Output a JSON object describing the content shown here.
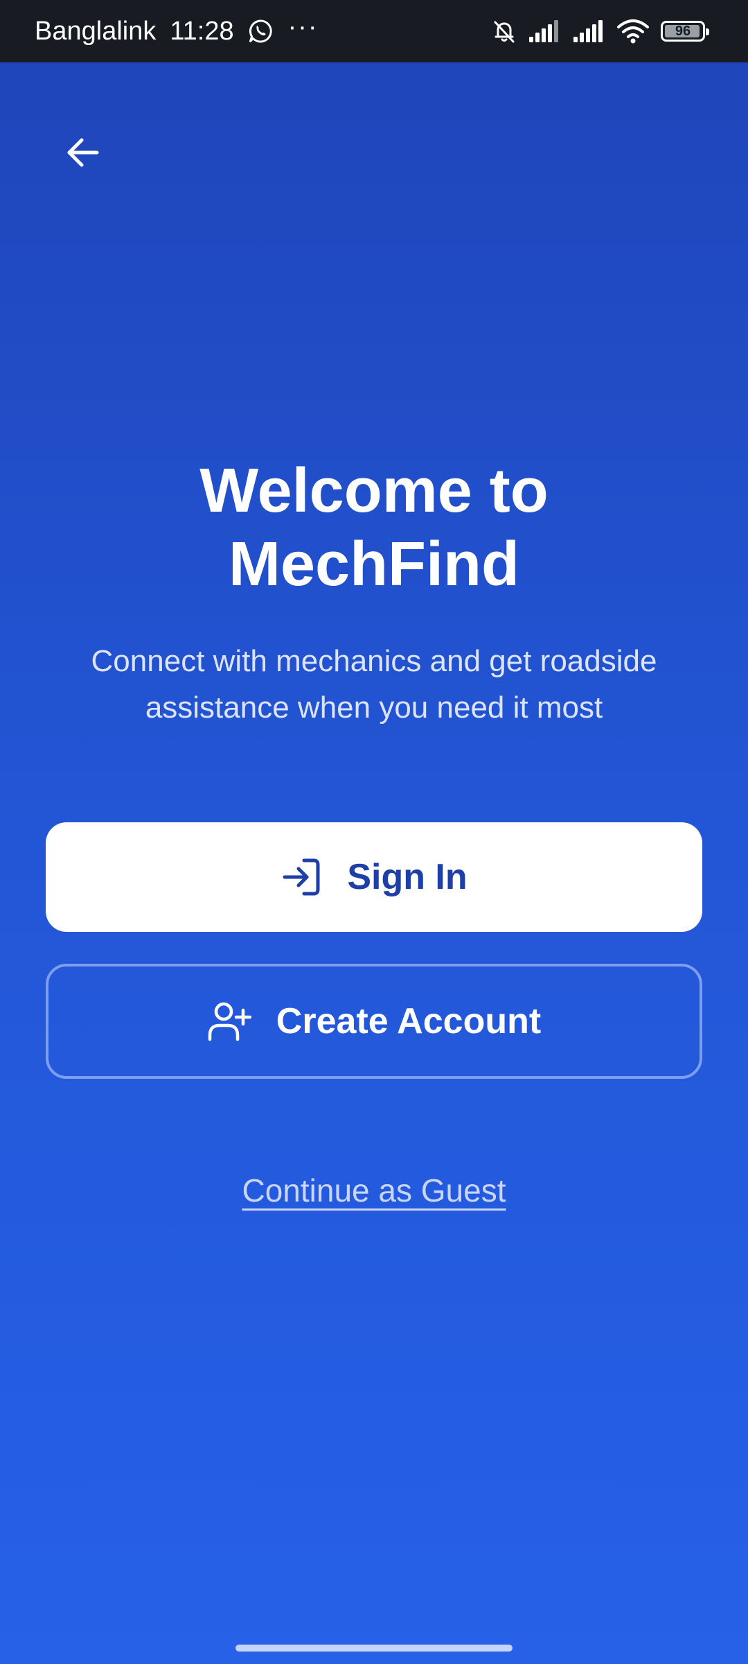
{
  "status_bar": {
    "carrier": "Banglalink",
    "time": "11:28",
    "more": "···",
    "battery_level": "96",
    "battery_fraction": 0.96,
    "icons": [
      "whatsapp-icon",
      "bell-off-icon",
      "signal-icon",
      "signal-icon",
      "wifi-icon",
      "battery-icon"
    ]
  },
  "header": {
    "back_icon": "arrow-left-icon"
  },
  "welcome": {
    "title_line1": "Welcome to",
    "title_line2": "MechFind",
    "subtitle_line1": "Connect with mechanics and get roadside",
    "subtitle_line2": "assistance when you need it most"
  },
  "actions": {
    "sign_in_label": "Sign In",
    "sign_in_icon": "log-in-icon",
    "create_account_label": "Create Account",
    "create_account_icon": "user-plus-icon",
    "guest_label": "Continue as Guest"
  },
  "colors": {
    "background_top": "#1f44b8",
    "background_bottom": "#2661e8",
    "primary_text": "#1f3fa8",
    "status_bar": "#181b22"
  }
}
